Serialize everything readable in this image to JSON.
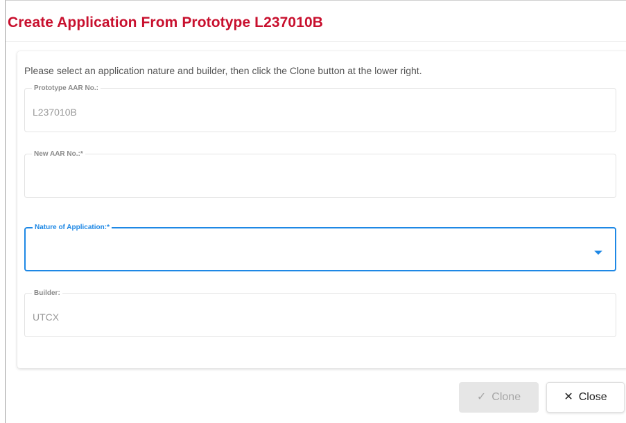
{
  "dialog": {
    "title": "Create Application From Prototype L237010B",
    "instructions": "Please select an application nature and builder, then click the Clone button at the lower right."
  },
  "fields": {
    "prototype_aar": {
      "label": "Prototype AAR No.:",
      "value": "L237010B"
    },
    "new_aar": {
      "label": "New AAR No.:*",
      "value": ""
    },
    "nature": {
      "label": "Nature of Application:*",
      "value": ""
    },
    "builder": {
      "label": "Builder:",
      "value": "UTCX"
    }
  },
  "buttons": {
    "clone_label": "Clone",
    "clone_icon": "✓",
    "close_label": "Close",
    "close_icon": "✕"
  },
  "colors": {
    "title": "#c8102e",
    "focus_accent": "#1e88e5",
    "disabled_button": "#e6e6e6"
  }
}
